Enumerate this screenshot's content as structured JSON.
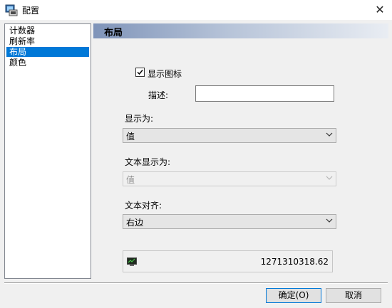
{
  "window": {
    "title": "配置"
  },
  "nav": {
    "items": [
      "计数器",
      "刷新率",
      "布局",
      "颜色"
    ],
    "selected": "布局"
  },
  "panel": {
    "title": "布局",
    "show_icon": {
      "label": "显示图标",
      "checked": true
    },
    "description": {
      "label": "描述:",
      "value": ""
    },
    "display_as": {
      "label": "显示为:",
      "value": "值"
    },
    "text_display_as": {
      "label": "文本显示为:",
      "value": "值",
      "disabled": true
    },
    "text_align": {
      "label": "文本对齐:",
      "value": "右边"
    },
    "preview": {
      "value": "1271310318.62"
    }
  },
  "buttons": {
    "ok_label": "确定(O)",
    "cancel_label": "取消"
  },
  "icons": {
    "app": "app-settings-icon",
    "close": "close-icon",
    "check": "checkmark-icon",
    "chevron": "chevron-down-icon",
    "preview": "monitor-icon"
  },
  "colors": {
    "selection": "#0078d7",
    "header_gradient_start": "#7f94b9",
    "header_gradient_end": "#e9edf3"
  }
}
